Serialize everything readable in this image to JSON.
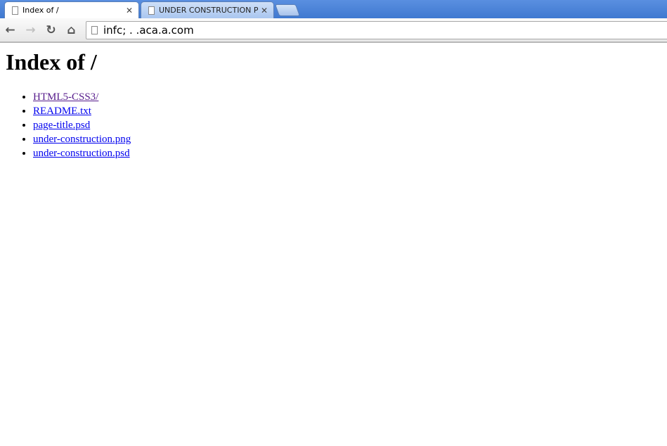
{
  "browser": {
    "tabs": [
      {
        "title": "Index of /",
        "active": true
      },
      {
        "title": "UNDER CONSTRUCTION PAGE",
        "active": false
      }
    ],
    "address": "infc;  . .aca.a.com",
    "icons": {
      "back": "arrow-left-icon",
      "forward": "arrow-right-icon",
      "reload": "reload-icon",
      "home": "home-icon",
      "page": "page-icon",
      "close": "close-icon"
    }
  },
  "page": {
    "heading": "Index of /",
    "links": [
      {
        "label": "HTML5-CSS3/",
        "visited": true
      },
      {
        "label": "README.txt"
      },
      {
        "label": "page-title.psd"
      },
      {
        "label": "under-construction.png"
      },
      {
        "label": "under-construction.psd"
      }
    ]
  },
  "colors": {
    "link": "#0000ee",
    "visited": "#551a8b",
    "titlebar": "#4f86d8"
  }
}
